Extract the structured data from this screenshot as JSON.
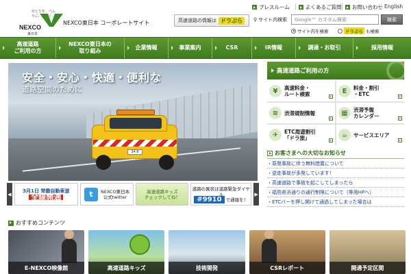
{
  "header": {
    "tagline": "ゆとりを、べんりに、ウェイ。",
    "logo_text": "NEXCO",
    "logo_sub": "東日本",
    "site_name": "NEXCO東日本 コーポレートサイト",
    "utility_links": [
      "プレスルーム",
      "よくあるご質問",
      "お問い合わせ",
      "English"
    ],
    "dorapura_prefix": "高速道路の情報は",
    "dorapura_name": "ドラぷら",
    "search_label": "サイト内検索",
    "search_placeholder": "Google™ カスタム検索",
    "search_button": "検索",
    "radio_site": "サイト内を検索",
    "radio_dorapura_name": "ドラぷら",
    "radio_dorapura_suffix": "も検索"
  },
  "nav": {
    "items": [
      {
        "line1": "高速道路",
        "line2": "ご利用の方"
      },
      {
        "line1": "NEXCO東日本の",
        "line2": "取り組み"
      },
      {
        "line1": "企業情報",
        "line2": ""
      },
      {
        "line1": "事業案内",
        "line2": ""
      },
      {
        "line1": "CSR",
        "line2": ""
      },
      {
        "line1": "IR情報",
        "line2": ""
      },
      {
        "line1": "調達・お取引",
        "line2": ""
      },
      {
        "line1": "採用情報",
        "line2": ""
      }
    ]
  },
  "hero": {
    "title": "安全・安心・快適・便利な",
    "subtitle": "道路空間のために",
    "plate": "34-6"
  },
  "banners": {
    "open_top": "3月1日 常磐自動車道",
    "open_big": "全線開通",
    "twitter_label": "NEXCO東日本",
    "twitter_sub": "公式twitter",
    "kids_label": "高速道路キッズ",
    "kids_sub": "チェックしてね！",
    "dial_top": "道路の異状は道路緊急ダイヤル",
    "dial_num": "#9910",
    "dial_suffix": "で通報を！",
    "prev": "◀",
    "next": "▶"
  },
  "right": {
    "heading": "高速道路ご利用の方",
    "services": [
      {
        "line1": "高速料金・",
        "line2": "ルート検索",
        "icon": "¥"
      },
      {
        "line1": "料金・割引",
        "line2": "・ETC",
        "icon": "E"
      },
      {
        "line1": "渋滞規制情報",
        "line2": "",
        "icon": "≋"
      },
      {
        "line1": "渋滞予報",
        "line2": "カレンダー",
        "icon": "▦"
      },
      {
        "line1": "ETC周遊割引",
        "line2": "「ドラ旅」",
        "icon": "✈"
      },
      {
        "line1": "サービスエリア",
        "line2": "",
        "icon": "☕"
      }
    ],
    "notice_title": "お客さまへの大切なお知らせ",
    "notices": [
      "・原発事故に伴う無料措置について",
      "・逆走事故が多発しています！",
      "・高速道路で事故を起こしてしまったら",
      "・福島県浜通りの通行制限について（専用HPへ）",
      "・ETCバーを押し開けて通過してしまった場合は"
    ]
  },
  "recommended": {
    "title": "おすすめコンテンツ",
    "items": [
      "E-NEXCO映像館",
      "高速道路キッズ",
      "技術開発",
      "CSRレポート",
      "開通予定区間"
    ]
  },
  "colors": {
    "brand_green": "#4a7f24",
    "nav_green": "#5d9a33",
    "link_blue": "#1b3f9a"
  }
}
